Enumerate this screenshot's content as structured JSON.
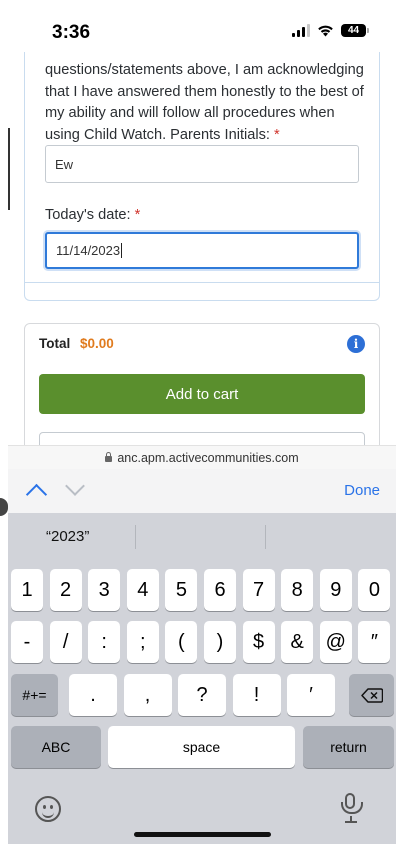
{
  "status_bar": {
    "time": "3:36",
    "battery": "44"
  },
  "form": {
    "consent_text": "questions/statements above, I am acknowledging that I have answered them honestly to the best of my ability and will follow all procedures when using Child Watch. Parents Initials:",
    "required_mark": "*",
    "initials_value": "Ew",
    "date_label": "Today's date:",
    "date_value": "11/14/2023"
  },
  "cart": {
    "total_label": "Total",
    "total_amount": "$0.00",
    "info_icon": "i",
    "add_button": "Add to cart"
  },
  "browser": {
    "url": "anc.apm.activecommunities.com"
  },
  "accessory_bar": {
    "done_label": "Done"
  },
  "keyboard": {
    "suggestion": "“2023”",
    "row1": [
      "1",
      "2",
      "3",
      "4",
      "5",
      "6",
      "7",
      "8",
      "9",
      "0"
    ],
    "row2": [
      "-",
      "/",
      ":",
      ";",
      "(",
      ")",
      "$",
      "&",
      "@",
      "″"
    ],
    "row3_switch": "#+=",
    "row3": [
      ".",
      ",",
      "?",
      "!",
      "′"
    ],
    "abc_label": "ABC",
    "space_label": "space",
    "return_label": "return"
  }
}
